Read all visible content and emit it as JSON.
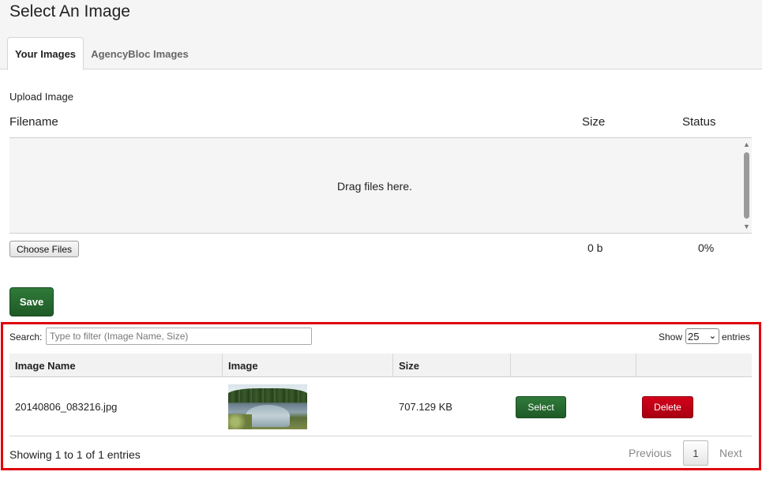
{
  "page": {
    "title": "Select An Image"
  },
  "tabs": [
    {
      "label": "Your Images",
      "active": true
    },
    {
      "label": "AgencyBloc Images",
      "active": false
    }
  ],
  "upload": {
    "label": "Upload Image",
    "columns": {
      "filename": "Filename",
      "size": "Size",
      "status": "Status"
    },
    "dropzone_text": "Drag files here.",
    "choose_button": "Choose Files",
    "total_size": "0 b",
    "total_status": "0%"
  },
  "save_button": "Save",
  "table": {
    "search_label": "Search:",
    "search_value": "",
    "search_placeholder": "Type to filter (Image Name, Size)",
    "show_label": "Show",
    "entries_value": "25",
    "entries_label": "entries",
    "columns": [
      "Image Name",
      "Image",
      "Size",
      "",
      ""
    ],
    "rows": [
      {
        "name": "20140806_083216.jpg",
        "size": "707.129 KB",
        "select_label": "Select",
        "delete_label": "Delete"
      }
    ],
    "info": "Showing 1 to 1 of 1 entries",
    "pagination": {
      "previous": "Previous",
      "current": "1",
      "next": "Next"
    }
  },
  "colors": {
    "accent_green": "#2f7a3a",
    "danger_red": "#c8001a",
    "highlight_border": "#e0000f"
  },
  "icons": {
    "dropdown": "chevron-down-icon",
    "scroll_up": "scroll-up-arrow-icon",
    "scroll_down": "scroll-down-arrow-icon"
  }
}
